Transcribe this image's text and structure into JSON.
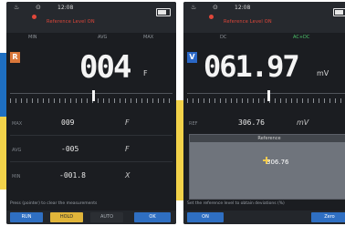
{
  "left": {
    "status": {
      "time": "12:08",
      "alert": "Reference Level ON"
    },
    "tabs": [
      "MIN",
      "AVG",
      "MAX"
    ],
    "mode_badge": "R",
    "main_reading": "004",
    "main_unit": "F",
    "stats": [
      {
        "label": "MAX",
        "value": "009",
        "unit": "F"
      },
      {
        "label": "AVG",
        "value": "-005",
        "unit": "F"
      },
      {
        "label": "MIN",
        "value": "-001.8",
        "unit": "X"
      }
    ],
    "message": "Press (pointer) to clear the measurements",
    "softkeys": [
      "RUN",
      "HOLD",
      "AUTO",
      "OK"
    ]
  },
  "right": {
    "status": {
      "time": "12:08",
      "alert": "Reference Level ON"
    },
    "tabs": [
      "DC",
      "AC+DC"
    ],
    "mode_badge": "V",
    "main_reading": "061.97",
    "main_unit": "mV",
    "stats": [
      {
        "label": "REF",
        "value": "306.76",
        "unit": "mV"
      }
    ],
    "graph": {
      "title": "Reference",
      "value": "306.76"
    },
    "message": "Set the reference level to obtain deviations (%)",
    "softkeys": [
      "ON",
      "Zero"
    ]
  },
  "colors": {
    "screen_bg": "#1b1d21",
    "badge_orange": "#d9773a",
    "badge_blue": "#2a67c6",
    "softkey_blue": "#2f6fc2",
    "softkey_yellow": "#e1b53a",
    "alert_red": "#e0473a"
  },
  "icons": [
    "thermometer-icon",
    "record-icon",
    "battery-icon",
    "crosshair-icon"
  ]
}
